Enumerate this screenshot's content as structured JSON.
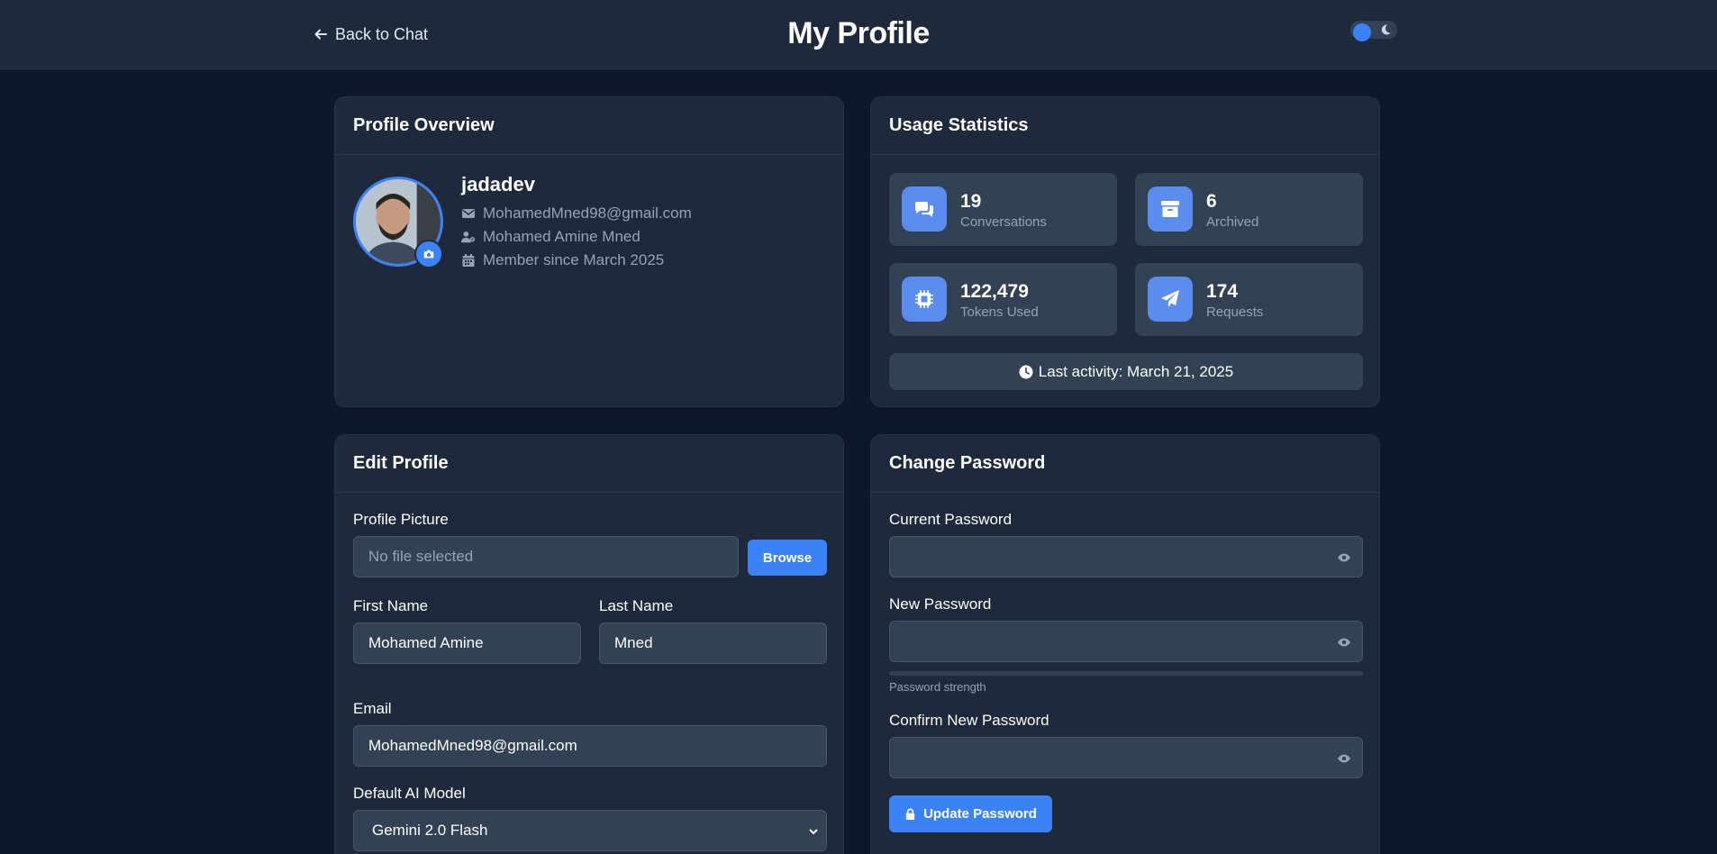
{
  "header": {
    "back_label": "Back to Chat",
    "title": "My Profile"
  },
  "overview": {
    "title": "Profile Overview",
    "username": "jadadev",
    "email": "MohamedMned98@gmail.com",
    "full_name": "Mohamed Amine Mned",
    "member_since": "Member since March 2025"
  },
  "stats": {
    "title": "Usage Statistics",
    "items": [
      {
        "value": "19",
        "label": "Conversations",
        "icon": "comments-icon"
      },
      {
        "value": "6",
        "label": "Archived",
        "icon": "archive-icon"
      },
      {
        "value": "122,479",
        "label": "Tokens Used",
        "icon": "chip-icon"
      },
      {
        "value": "174",
        "label": "Requests",
        "icon": "paper-plane-icon"
      }
    ],
    "last_activity": "Last activity: March 21, 2025"
  },
  "edit_profile": {
    "title": "Edit Profile",
    "picture_label": "Profile Picture",
    "picture_placeholder": "No file selected",
    "browse_label": "Browse",
    "first_name_label": "First Name",
    "first_name_value": "Mohamed Amine",
    "last_name_label": "Last Name",
    "last_name_value": "Mned",
    "email_label": "Email",
    "email_value": "MohamedMned98@gmail.com",
    "model_label": "Default AI Model",
    "model_value": "Gemini 2.0 Flash"
  },
  "password": {
    "title": "Change Password",
    "current_label": "Current Password",
    "new_label": "New Password",
    "strength_label": "Password strength",
    "confirm_label": "Confirm New Password",
    "update_label": "Update Password"
  },
  "colors": {
    "accent": "#3b82f6",
    "background": "#0f172a",
    "card": "#1e293b",
    "field": "#334155"
  }
}
